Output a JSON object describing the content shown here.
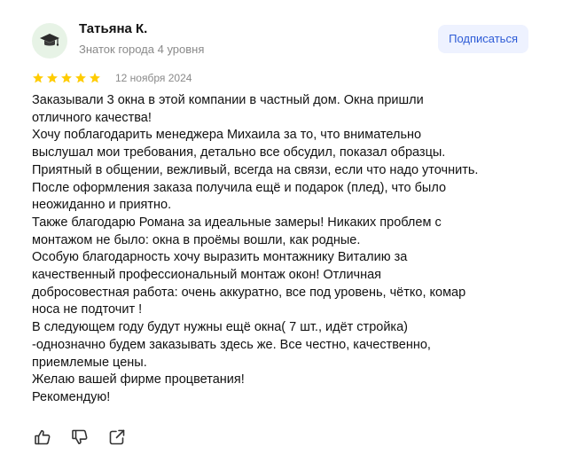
{
  "author": {
    "name": "Татьяна К.",
    "rank": "Знаток города 4 уровня",
    "avatar_icon": "graduation-cap-icon",
    "avatar_bg": "#e7f3e6"
  },
  "subscribe": {
    "label": "Подписаться",
    "color": "#2d5bd6",
    "background": "#eef2ff"
  },
  "rating": {
    "stars": 5,
    "max": 5,
    "star_color": "#ffcc00"
  },
  "date": "12 ноября 2024",
  "review": {
    "lines": [
      "Заказывали 3 окна в этой компании в частный дом. Окна пришли",
      "отличного качества!",
      "Хочу поблагодарить менеджера Михаила за то, что внимательно",
      "выслушал мои требования, детально все обсудил, показал образцы.",
      "Приятный в общении, вежливый, всегда на связи, если что надо уточнить.",
      "После оформления заказа получила ещё и подарок (плед), что было",
      "неожиданно и приятно.",
      "Также благодарю Романа за идеальные замеры! Никаких проблем с",
      "монтажом не было: окна в проёмы вошли, как родные.",
      "Особую благодарность хочу выразить монтажнику Виталию за",
      "качественный профессиональный монтаж окон! Отличная",
      "добросовестная работа: очень аккуратно, все под уровень, чётко, комар",
      "носа не подточит !",
      "В следующем году будут нужны ещё окна( 7 шт., идёт стройка)",
      "-однозначно будем заказывать здесь же. Все честно, качественно,",
      "приемлемые цены.",
      "Желаю вашей фирме процветания!",
      "Рекомендую!"
    ]
  },
  "actions": [
    {
      "name": "like",
      "icon": "thumbs-up-icon"
    },
    {
      "name": "dislike",
      "icon": "thumbs-down-icon"
    },
    {
      "name": "share",
      "icon": "share-icon"
    }
  ]
}
